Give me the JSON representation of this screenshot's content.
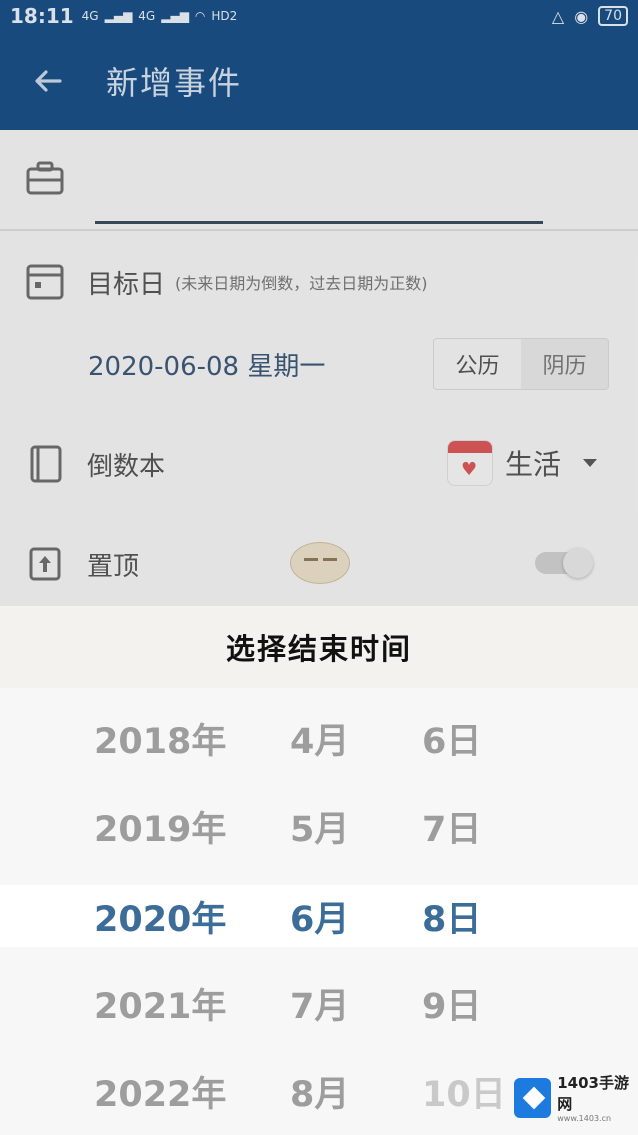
{
  "status_bar": {
    "time": "18:11",
    "signal_1": "4G",
    "signal_2": "4G",
    "hd": "HD2",
    "battery": "70"
  },
  "toolbar": {
    "title": "新增事件"
  },
  "form": {
    "name_value": "",
    "target_label": "目标日",
    "target_hint": "(未来日期为倒数，过去日期为正数)",
    "date_value": "2020-06-08 星期一",
    "calendar_options": [
      "公历",
      "阴历"
    ],
    "calendar_selected": "阴历",
    "book_label": "倒数本",
    "book_value": "生活",
    "pin_label": "置顶",
    "pin_enabled": false
  },
  "picker": {
    "title": "选择结束时间",
    "rows": [
      {
        "year": "2018年",
        "month": "4月",
        "day": "6日"
      },
      {
        "year": "2019年",
        "month": "5月",
        "day": "7日"
      },
      {
        "year": "2020年",
        "month": "6月",
        "day": "8日"
      },
      {
        "year": "2021年",
        "month": "7月",
        "day": "9日"
      },
      {
        "year": "2022年",
        "month": "8月",
        "day": "10日"
      }
    ],
    "selected_index": 2
  },
  "watermark": {
    "title": "1403手游网",
    "url": "www.1403.cn"
  },
  "colors": {
    "primary": "#1a4f86",
    "selected_text": "#3c6d98",
    "unselected_text": "#9d9d9d"
  }
}
